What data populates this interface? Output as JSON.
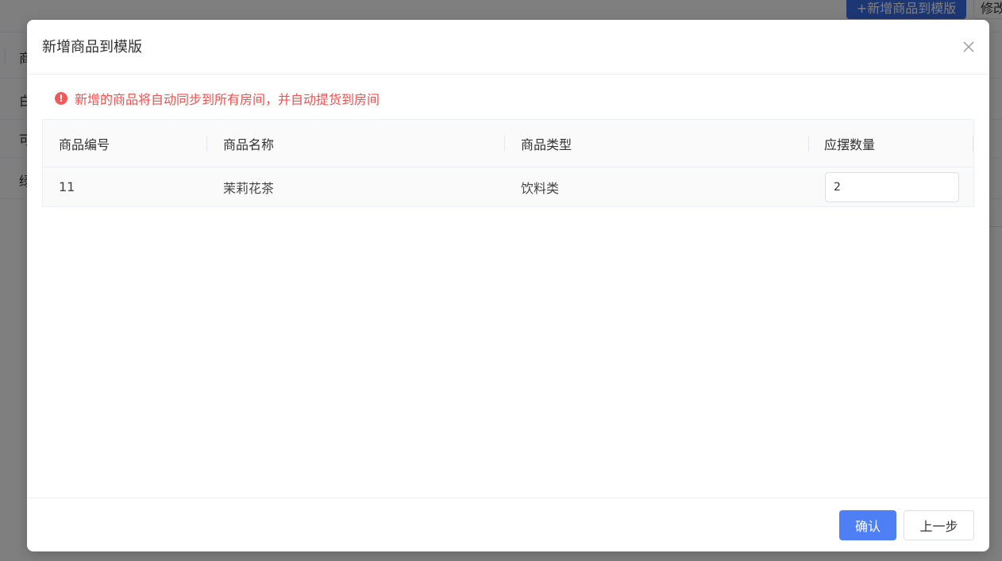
{
  "background": {
    "add_button_label": "+新增商品到模版",
    "edit_button_label": "修改",
    "row_fragments": [
      "商",
      "白",
      "可",
      "绿"
    ]
  },
  "dialog": {
    "title": "新增商品到模版",
    "notice": "新增的商品将自动同步到所有房间，并自动提货到房间",
    "notice_icon": "!",
    "columns": [
      "商品编号",
      "商品名称",
      "商品类型",
      "应摆数量"
    ],
    "rows": [
      {
        "id": "11",
        "name": "茉莉花茶",
        "type": "饮料类",
        "quantity": "2"
      }
    ],
    "confirm_label": "确认",
    "prev_label": "上一步"
  },
  "colors": {
    "primary": "#4e7ff5",
    "error": "#f0504f"
  }
}
